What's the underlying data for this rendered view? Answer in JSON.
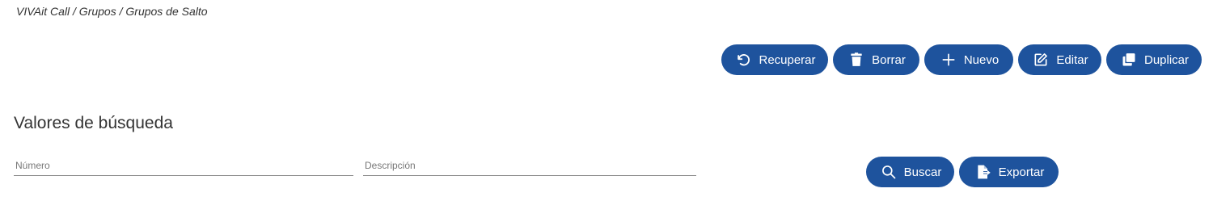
{
  "breadcrumb": "VIVAit Call / Grupos / Grupos de Salto",
  "toolbar": {
    "recuperar": {
      "label": "Recuperar",
      "icon": "undo-icon"
    },
    "borrar": {
      "label": "Borrar",
      "icon": "trash-icon"
    },
    "nuevo": {
      "label": "Nuevo",
      "icon": "plus-icon"
    },
    "editar": {
      "label": "Editar",
      "icon": "edit-icon"
    },
    "duplicar": {
      "label": "Duplicar",
      "icon": "copy-icon"
    }
  },
  "search": {
    "title": "Valores de búsqueda",
    "numero": {
      "placeholder": "Número",
      "value": ""
    },
    "descripcion": {
      "placeholder": "Descripción",
      "value": ""
    },
    "buscar": {
      "label": "Buscar",
      "icon": "search-icon"
    },
    "exportar": {
      "label": "Exportar",
      "icon": "export-icon"
    }
  },
  "colors": {
    "button_bg": "#1e539d",
    "button_text": "#ffffff",
    "field_underline": "#8a8a8a"
  }
}
